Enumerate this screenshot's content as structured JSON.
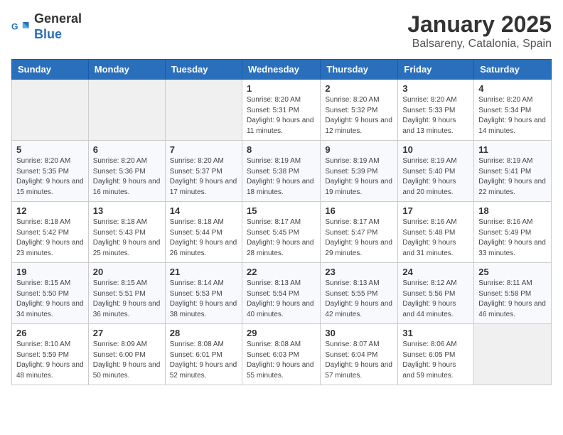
{
  "logo": {
    "general": "General",
    "blue": "Blue"
  },
  "header": {
    "month": "January 2025",
    "location": "Balsareny, Catalonia, Spain"
  },
  "weekdays": [
    "Sunday",
    "Monday",
    "Tuesday",
    "Wednesday",
    "Thursday",
    "Friday",
    "Saturday"
  ],
  "weeks": [
    [
      {
        "day": null
      },
      {
        "day": null
      },
      {
        "day": null
      },
      {
        "day": "1",
        "sunrise": "8:20 AM",
        "sunset": "5:31 PM",
        "daylight": "9 hours and 11 minutes."
      },
      {
        "day": "2",
        "sunrise": "8:20 AM",
        "sunset": "5:32 PM",
        "daylight": "9 hours and 12 minutes."
      },
      {
        "day": "3",
        "sunrise": "8:20 AM",
        "sunset": "5:33 PM",
        "daylight": "9 hours and 13 minutes."
      },
      {
        "day": "4",
        "sunrise": "8:20 AM",
        "sunset": "5:34 PM",
        "daylight": "9 hours and 14 minutes."
      }
    ],
    [
      {
        "day": "5",
        "sunrise": "8:20 AM",
        "sunset": "5:35 PM",
        "daylight": "9 hours and 15 minutes."
      },
      {
        "day": "6",
        "sunrise": "8:20 AM",
        "sunset": "5:36 PM",
        "daylight": "9 hours and 16 minutes."
      },
      {
        "day": "7",
        "sunrise": "8:20 AM",
        "sunset": "5:37 PM",
        "daylight": "9 hours and 17 minutes."
      },
      {
        "day": "8",
        "sunrise": "8:19 AM",
        "sunset": "5:38 PM",
        "daylight": "9 hours and 18 minutes."
      },
      {
        "day": "9",
        "sunrise": "8:19 AM",
        "sunset": "5:39 PM",
        "daylight": "9 hours and 19 minutes."
      },
      {
        "day": "10",
        "sunrise": "8:19 AM",
        "sunset": "5:40 PM",
        "daylight": "9 hours and 20 minutes."
      },
      {
        "day": "11",
        "sunrise": "8:19 AM",
        "sunset": "5:41 PM",
        "daylight": "9 hours and 22 minutes."
      }
    ],
    [
      {
        "day": "12",
        "sunrise": "8:18 AM",
        "sunset": "5:42 PM",
        "daylight": "9 hours and 23 minutes."
      },
      {
        "day": "13",
        "sunrise": "8:18 AM",
        "sunset": "5:43 PM",
        "daylight": "9 hours and 25 minutes."
      },
      {
        "day": "14",
        "sunrise": "8:18 AM",
        "sunset": "5:44 PM",
        "daylight": "9 hours and 26 minutes."
      },
      {
        "day": "15",
        "sunrise": "8:17 AM",
        "sunset": "5:45 PM",
        "daylight": "9 hours and 28 minutes."
      },
      {
        "day": "16",
        "sunrise": "8:17 AM",
        "sunset": "5:47 PM",
        "daylight": "9 hours and 29 minutes."
      },
      {
        "day": "17",
        "sunrise": "8:16 AM",
        "sunset": "5:48 PM",
        "daylight": "9 hours and 31 minutes."
      },
      {
        "day": "18",
        "sunrise": "8:16 AM",
        "sunset": "5:49 PM",
        "daylight": "9 hours and 33 minutes."
      }
    ],
    [
      {
        "day": "19",
        "sunrise": "8:15 AM",
        "sunset": "5:50 PM",
        "daylight": "9 hours and 34 minutes."
      },
      {
        "day": "20",
        "sunrise": "8:15 AM",
        "sunset": "5:51 PM",
        "daylight": "9 hours and 36 minutes."
      },
      {
        "day": "21",
        "sunrise": "8:14 AM",
        "sunset": "5:53 PM",
        "daylight": "9 hours and 38 minutes."
      },
      {
        "day": "22",
        "sunrise": "8:13 AM",
        "sunset": "5:54 PM",
        "daylight": "9 hours and 40 minutes."
      },
      {
        "day": "23",
        "sunrise": "8:13 AM",
        "sunset": "5:55 PM",
        "daylight": "9 hours and 42 minutes."
      },
      {
        "day": "24",
        "sunrise": "8:12 AM",
        "sunset": "5:56 PM",
        "daylight": "9 hours and 44 minutes."
      },
      {
        "day": "25",
        "sunrise": "8:11 AM",
        "sunset": "5:58 PM",
        "daylight": "9 hours and 46 minutes."
      }
    ],
    [
      {
        "day": "26",
        "sunrise": "8:10 AM",
        "sunset": "5:59 PM",
        "daylight": "9 hours and 48 minutes."
      },
      {
        "day": "27",
        "sunrise": "8:09 AM",
        "sunset": "6:00 PM",
        "daylight": "9 hours and 50 minutes."
      },
      {
        "day": "28",
        "sunrise": "8:08 AM",
        "sunset": "6:01 PM",
        "daylight": "9 hours and 52 minutes."
      },
      {
        "day": "29",
        "sunrise": "8:08 AM",
        "sunset": "6:03 PM",
        "daylight": "9 hours and 55 minutes."
      },
      {
        "day": "30",
        "sunrise": "8:07 AM",
        "sunset": "6:04 PM",
        "daylight": "9 hours and 57 minutes."
      },
      {
        "day": "31",
        "sunrise": "8:06 AM",
        "sunset": "6:05 PM",
        "daylight": "9 hours and 59 minutes."
      },
      {
        "day": null
      }
    ]
  ],
  "labels": {
    "sunrise": "Sunrise:",
    "sunset": "Sunset:",
    "daylight": "Daylight:"
  }
}
